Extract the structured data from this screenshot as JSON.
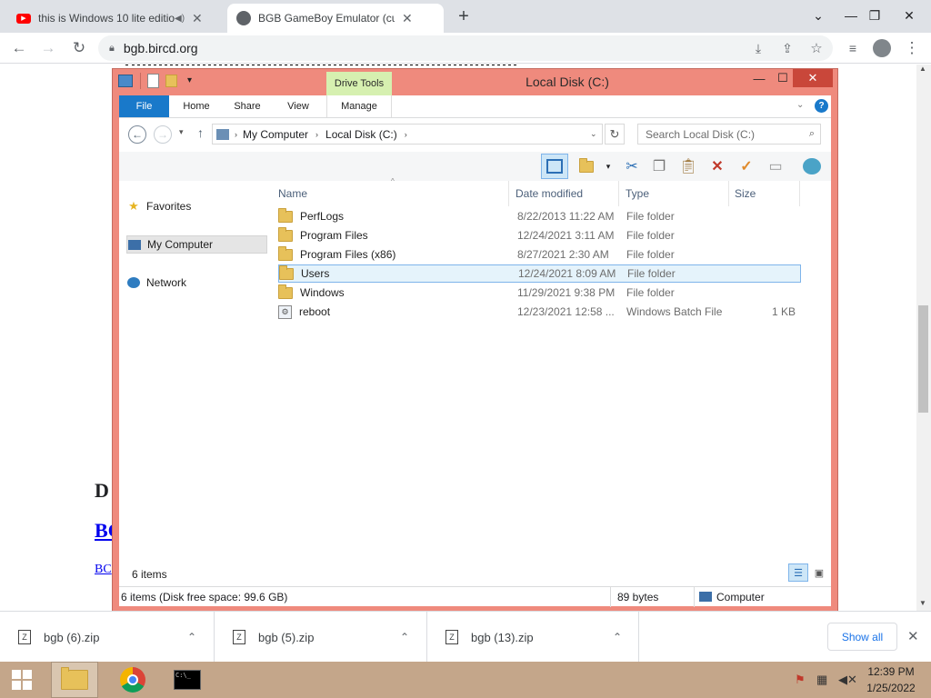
{
  "browser": {
    "tabs": [
      {
        "title": "this is Windows 10 lite editio",
        "icon": "youtube-icon",
        "muted_icon": "speaker-icon"
      },
      {
        "title": "BGB GameBoy Emulator (current",
        "icon": "globe-icon"
      }
    ],
    "new_tab": "+",
    "url": "bgb.bircd.org",
    "window_controls": {
      "minimize": "—",
      "restore": "❐",
      "close": "✕",
      "tab_search": "⌄"
    }
  },
  "page": {
    "heading_fragment": "D",
    "link_fragment": "BG",
    "small_link_fragment": "BC"
  },
  "explorer": {
    "title": "Local Disk (C:)",
    "contextual_group": "Drive Tools",
    "ribbon_tabs": [
      "File",
      "Home",
      "Share",
      "View",
      "Manage"
    ],
    "breadcrumb": [
      "My Computer",
      "Local Disk (C:)"
    ],
    "search_placeholder": "Search Local Disk (C:)",
    "nav_pane": [
      {
        "label": "Favorites",
        "icon": "star-icon"
      },
      {
        "label": "My Computer",
        "icon": "computer-icon"
      },
      {
        "label": "Network",
        "icon": "network-icon"
      }
    ],
    "columns": [
      "Name",
      "Date modified",
      "Type",
      "Size"
    ],
    "rows": [
      {
        "name": "PerfLogs",
        "date": "8/22/2013 11:22 AM",
        "type": "File folder",
        "size": "",
        "icon": "folder-icon"
      },
      {
        "name": "Program Files",
        "date": "12/24/2021 3:11 AM",
        "type": "File folder",
        "size": "",
        "icon": "folder-icon"
      },
      {
        "name": "Program Files (x86)",
        "date": "8/27/2021 2:30 AM",
        "type": "File folder",
        "size": "",
        "icon": "folder-icon"
      },
      {
        "name": "Users",
        "date": "12/24/2021 8:09 AM",
        "type": "File folder",
        "size": "",
        "icon": "folder-icon",
        "selected": true
      },
      {
        "name": "Windows",
        "date": "11/29/2021 9:38 PM",
        "type": "File folder",
        "size": "",
        "icon": "folder-icon"
      },
      {
        "name": "reboot",
        "date": "12/23/2021 12:58 ...",
        "type": "Windows Batch File",
        "size": "1 KB",
        "icon": "batch-file-icon"
      }
    ],
    "item_count": "6 items",
    "status_left": "6 items (Disk free space: 99.6 GB)",
    "status_mid": "89 bytes",
    "status_right": "Computer",
    "accent_color": "#ef8a7d"
  },
  "downloads": {
    "items": [
      "bgb (6).zip",
      "bgb (5).zip",
      "bgb (13).zip"
    ],
    "show_all": "Show all"
  },
  "taskbar": {
    "time": "12:39 PM",
    "date": "1/25/2022"
  }
}
